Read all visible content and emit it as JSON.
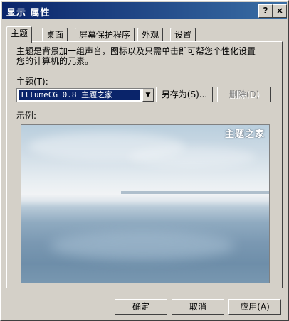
{
  "window": {
    "title": "显示 属性",
    "help_button": "?",
    "close_button": "×"
  },
  "tabs": [
    {
      "label": "主题",
      "active": true
    },
    {
      "label": "桌面",
      "active": false
    },
    {
      "label": "屏幕保护程序",
      "active": false
    },
    {
      "label": "外观",
      "active": false
    },
    {
      "label": "设置",
      "active": false
    }
  ],
  "theme_page": {
    "description_line1": "主题是背景加一组声音，图标以及只需单击即可帮您个性化设置",
    "description_line2": "您的计算机的元素。",
    "theme_label": "主题(T):",
    "theme_selected": "IllumeCG 0.8 主题之家",
    "save_as_button": "另存为(S)...",
    "delete_button": "删除(D)",
    "sample_label": "示例:",
    "preview_watermark": "主题之家"
  },
  "footer": {
    "ok_button": "确定",
    "cancel_button": "取消",
    "apply_button": "应用(A)"
  },
  "colors": {
    "titlebar_start": "#0a246a",
    "titlebar_end": "#3a6ea5",
    "window_face": "#d4d0c8",
    "selection": "#0a246a"
  }
}
